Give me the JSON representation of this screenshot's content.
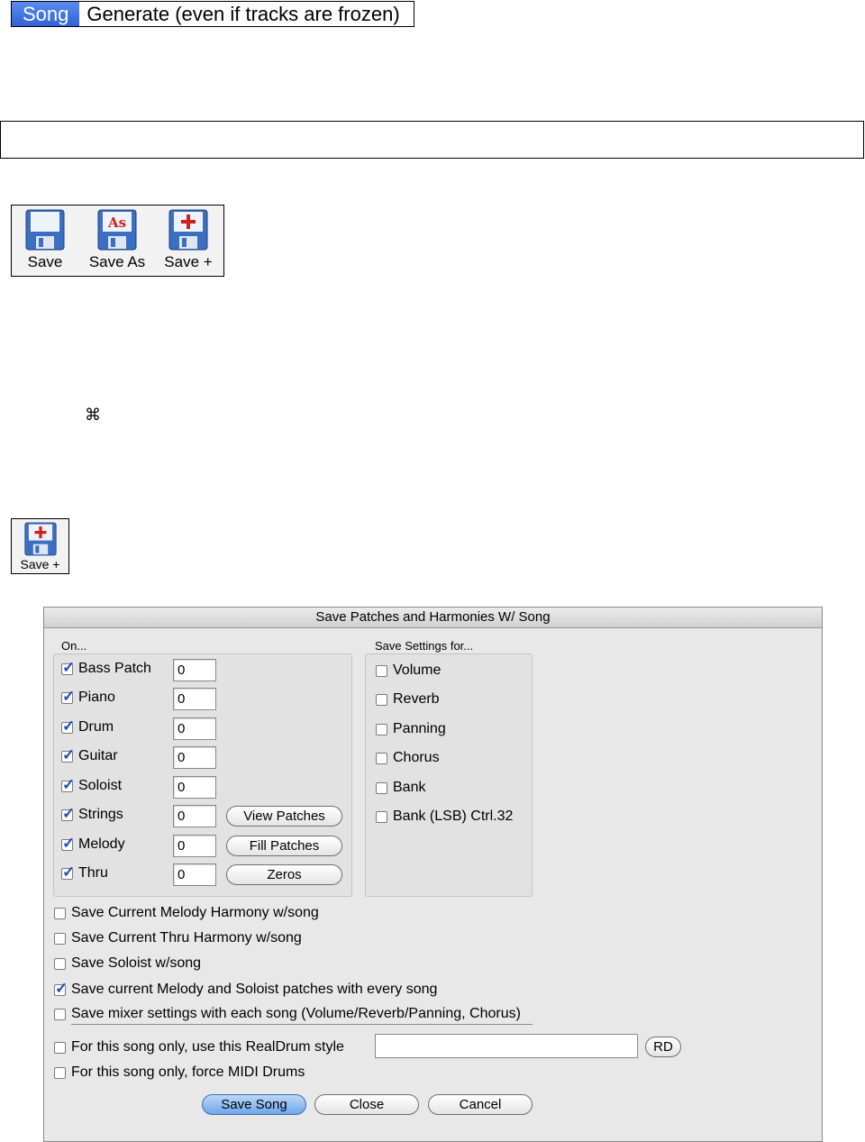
{
  "menu": {
    "tag": "Song",
    "command": "Generate (even if tracks are frozen)"
  },
  "toolbar": {
    "save_label": "Save",
    "save_as_label": "Save As",
    "save_plus_label": "Save +",
    "save_as_badge": "As",
    "colors": {
      "disk_blue": "#3b6fc2",
      "disk_red": "#d02020"
    }
  },
  "command_glyph": "⌘",
  "small_toolbar": {
    "save_plus_label": "Save +"
  },
  "dialog": {
    "title": "Save Patches and Harmonies W/ Song",
    "on_label": "On...",
    "settings_label": "Save Settings for...",
    "patches": [
      {
        "label": "Bass Patch",
        "checked": true,
        "value": "0"
      },
      {
        "label": "Piano",
        "checked": true,
        "value": "0"
      },
      {
        "label": "Drum",
        "checked": true,
        "value": "0"
      },
      {
        "label": "Guitar",
        "checked": true,
        "value": "0"
      },
      {
        "label": "Soloist",
        "checked": true,
        "value": "0"
      },
      {
        "label": "Strings",
        "checked": true,
        "value": "0"
      },
      {
        "label": "Melody",
        "checked": true,
        "value": "0"
      },
      {
        "label": "Thru",
        "checked": true,
        "value": "0"
      }
    ],
    "view_patches": "View Patches",
    "fill_patches": "Fill Patches",
    "zeros": "Zeros",
    "settings": [
      {
        "label": "Volume",
        "checked": false
      },
      {
        "label": "Reverb",
        "checked": false
      },
      {
        "label": "Panning",
        "checked": false
      },
      {
        "label": "Chorus",
        "checked": false
      },
      {
        "label": "Bank",
        "checked": false
      },
      {
        "label": "Bank (LSB) Ctrl.32",
        "checked": false
      }
    ],
    "options": [
      {
        "label": "Save Current Melody Harmony w/song",
        "checked": false
      },
      {
        "label": "Save Current Thru Harmony w/song",
        "checked": false
      },
      {
        "label": "Save Soloist w/song",
        "checked": false
      },
      {
        "label": "Save current Melody and Soloist patches with every song",
        "checked": true
      },
      {
        "label": "Save mixer settings with each song (Volume/Reverb/Panning, Chorus)",
        "checked": false
      }
    ],
    "realdrum_label": "For this song only, use this RealDrum style",
    "realdrum_value": "",
    "rd_button": "RD",
    "midi_drums_label": "For this song only, force MIDI Drums",
    "save_song": "Save Song",
    "close": "Close",
    "cancel": "Cancel"
  }
}
